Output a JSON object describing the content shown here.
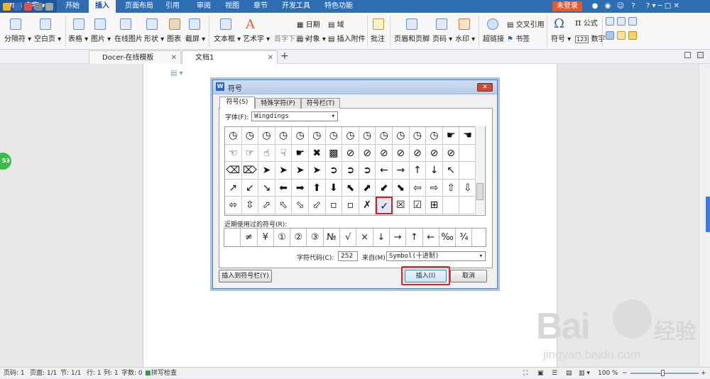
{
  "app": {
    "name": "WPS 文字",
    "login": "未登录"
  },
  "menu": [
    "开始",
    "插入",
    "页面布局",
    "引用",
    "审阅",
    "视图",
    "章节",
    "开发工具",
    "特色功能"
  ],
  "menu_active": "插入",
  "ribbon": {
    "row1": [
      "分隔符",
      "空白页",
      "表格",
      "图片",
      "在线图片",
      "形状",
      "图表",
      "截屏",
      "文本框",
      "艺术字",
      "日期",
      "域",
      "批注",
      "页眉和页脚",
      "页码",
      "水印",
      "超链接",
      "交叉引用",
      "符号",
      "公式"
    ],
    "row2": [
      "首字下沉",
      "对象",
      "插入附件",
      "书签",
      "数字"
    ]
  },
  "doc_tabs": [
    "Docer-在线模板",
    "文档1"
  ],
  "side_badge": "53",
  "dialog": {
    "title": "符号",
    "tabs": [
      "符号(S)",
      "特殊字符(P)",
      "符号栏(T)"
    ],
    "font_label": "字体(F):",
    "font_value": "Wingdings",
    "symbols": [
      [
        "◷",
        "◷",
        "◷",
        "◷",
        "◷",
        "◷",
        "◷",
        "◷",
        "◷",
        "◷",
        "◷",
        "◷",
        "◷",
        "☛",
        "☚"
      ],
      [
        "☜",
        "☞",
        "☝",
        "☟",
        "☛",
        "✖",
        "▩",
        "⊘",
        "⊘",
        "⊘",
        "⊘",
        "⊘",
        "⊘",
        "⊘",
        ""
      ],
      [
        "⌫",
        "⌦",
        "➤",
        "➤",
        "➤",
        "➤",
        "➲",
        "➲",
        "➲",
        "←",
        "→",
        "↑",
        "↓",
        "↖",
        ""
      ],
      [
        "↗",
        "↙",
        "↘",
        "⬅",
        "➡",
        "⬆",
        "⬇",
        "⬉",
        "⬈",
        "⬋",
        "⬊",
        "⇦",
        "⇨",
        "⇧",
        "⇩"
      ],
      [
        "⬄",
        "⇳",
        "⬀",
        "⬁",
        "⬂",
        "⬃",
        "▫",
        "▫",
        "✗",
        "✓",
        "☒",
        "☑",
        "⊞",
        "",
        ""
      ]
    ],
    "selected": "✓",
    "recent_label": "近期使用过的符号(R):",
    "recent": [
      "",
      "≠",
      "¥",
      "①",
      "②",
      "③",
      "№",
      "√",
      "×",
      "↓",
      "→",
      "↑",
      "←",
      "‰",
      "¾"
    ],
    "code_label": "字符代码(C):",
    "code_value": "252",
    "from_label": "来自(M)",
    "from_value": "Symbol(十进制)",
    "insert_bar": "插入到符号栏(Y)",
    "insert": "插入(I)",
    "cancel": "取消"
  },
  "status": {
    "page": "页码: 1",
    "pages": "页面: 1/1",
    "section": "节: 1/1",
    "row": "行: 1",
    "col": "列: 1",
    "words": "字数: 0",
    "spell": "拼写检查",
    "zoom": "100 %"
  },
  "watermark": {
    "brand": "Bai",
    "brand2": "经验",
    "url": "jingyan.baidu.com"
  }
}
